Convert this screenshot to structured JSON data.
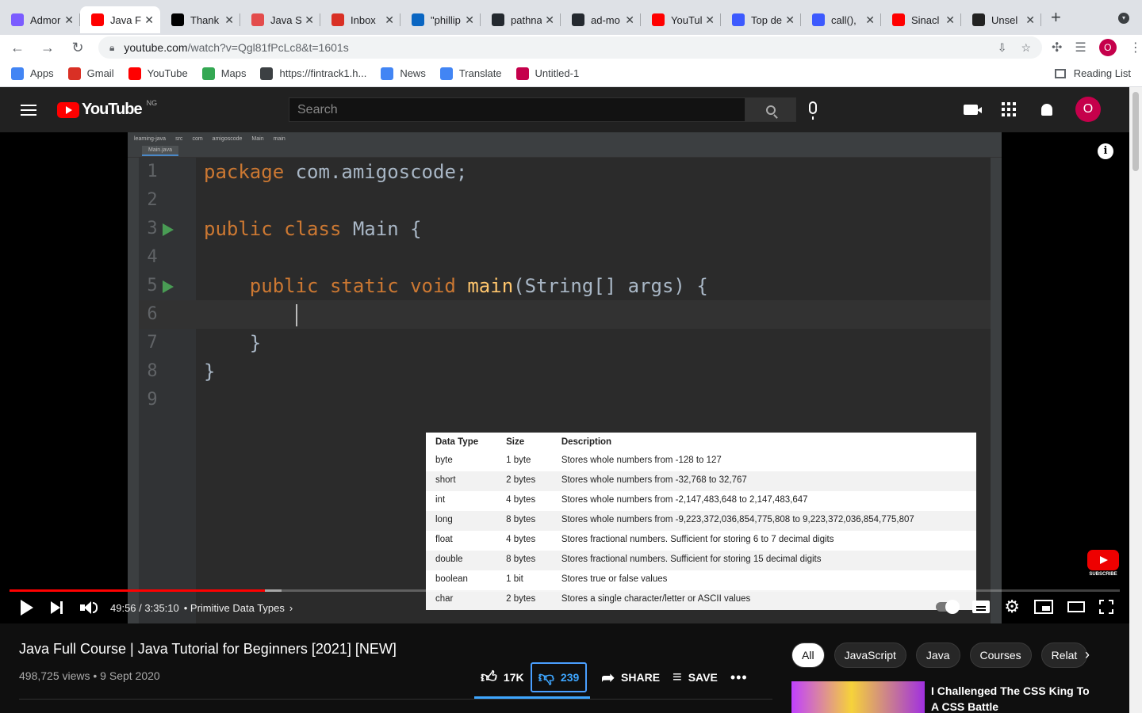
{
  "browser": {
    "tabs": [
      {
        "title": "Admor",
        "color": "#7b5cff",
        "active": false
      },
      {
        "title": "Java F",
        "color": "#ff0000",
        "active": true
      },
      {
        "title": "Thank",
        "color": "#000000",
        "active": false
      },
      {
        "title": "Java S",
        "color": "#e34c4c",
        "active": false
      },
      {
        "title": "Inbox",
        "color": "#d93025",
        "active": false
      },
      {
        "title": "\"phillip",
        "color": "#0a66c2",
        "active": false
      },
      {
        "title": "pathna",
        "color": "#24292f",
        "active": false
      },
      {
        "title": "ad-mo",
        "color": "#24292f",
        "active": false
      },
      {
        "title": "YouTul",
        "color": "#ff0000",
        "active": false
      },
      {
        "title": "Top de",
        "color": "#3d5afe",
        "active": false
      },
      {
        "title": "call(),",
        "color": "#3d5afe",
        "active": false
      },
      {
        "title": "Sinacl",
        "color": "#ff0000",
        "active": false
      },
      {
        "title": "Unsel",
        "color": "#222222",
        "active": false
      }
    ],
    "new_tab_glyph": "+",
    "url_host": "youtube.com",
    "url_path": "/watch?v=Qgl81fPcLc8&t=1601s",
    "profile_initial": "O",
    "bookmarks": [
      {
        "label": "Apps",
        "color": "#4285f4"
      },
      {
        "label": "Gmail",
        "color": "#d93025"
      },
      {
        "label": "YouTube",
        "color": "#ff0000"
      },
      {
        "label": "Maps",
        "color": "#34a853"
      },
      {
        "label": "https://fintrack1.h...",
        "color": "#3c4043"
      },
      {
        "label": "News",
        "color": "#4285f4"
      },
      {
        "label": "Translate",
        "color": "#4285f4"
      },
      {
        "label": "Untitled-1",
        "color": "#c5004b"
      }
    ],
    "reading_list": "Reading List"
  },
  "youtube": {
    "logo_text": "YouTube",
    "region": "NG",
    "search_placeholder": "Search",
    "avatar_initial": "O"
  },
  "video": {
    "ide_breadcrumb": [
      "learning-java",
      "src",
      "com",
      "amigoscode",
      "Main",
      "main"
    ],
    "ide_tab": "Main.java",
    "code_lines": [
      {
        "num": "1",
        "run": false,
        "current": false
      },
      {
        "num": "2",
        "run": false,
        "current": false
      },
      {
        "num": "3",
        "run": true,
        "current": false
      },
      {
        "num": "4",
        "run": false,
        "current": false
      },
      {
        "num": "5",
        "run": true,
        "current": false
      },
      {
        "num": "6",
        "run": false,
        "current": true
      },
      {
        "num": "7",
        "run": false,
        "current": false
      },
      {
        "num": "8",
        "run": false,
        "current": false
      },
      {
        "num": "9",
        "run": false,
        "current": false
      }
    ],
    "code_text": {
      "l1_kw": "package",
      "l1_rest": " com.amigoscode;",
      "l3_kw": "public class",
      "l3_rest": " Main {",
      "l5_kw": "public static void",
      "l5_fn": "main",
      "l5_rest": "(String[] args) {",
      "l7": "}",
      "l8": "}"
    },
    "table": {
      "headers": [
        "Data Type",
        "Size",
        "Description"
      ],
      "rows": [
        [
          "byte",
          "1 byte",
          "Stores whole numbers from -128 to 127"
        ],
        [
          "short",
          "2 bytes",
          "Stores whole numbers from -32,768 to 32,767"
        ],
        [
          "int",
          "4 bytes",
          "Stores whole numbers from -2,147,483,648 to 2,147,483,647"
        ],
        [
          "long",
          "8 bytes",
          "Stores whole numbers from -9,223,372,036,854,775,808 to 9,223,372,036,854,775,807"
        ],
        [
          "float",
          "4 bytes",
          "Stores fractional numbers. Sufficient for storing 6 to 7 decimal digits"
        ],
        [
          "double",
          "8 bytes",
          "Stores fractional numbers. Sufficient for storing 15 decimal digits"
        ],
        [
          "boolean",
          "1 bit",
          "Stores true or false values"
        ],
        [
          "char",
          "2 bytes",
          "Stores a single character/letter or ASCII values"
        ]
      ]
    },
    "subscribe_watermark": "SUBSCRIBE",
    "time_display": "49:56 / 3:35:10",
    "chapter": "• Primitive Data Types",
    "progress_played_fraction": 0.23,
    "progress_loaded_fraction": 0.245
  },
  "details": {
    "title": "Java Full Course | Java Tutorial for Beginners [2021] [NEW]",
    "meta": "498,725 views • 9 Sept 2020",
    "likes": "17K",
    "dislikes": "239",
    "share": "SHARE",
    "save": "SAVE",
    "more": "•••"
  },
  "sidebar": {
    "chips": [
      "All",
      "JavaScript",
      "Java",
      "Courses",
      "Relat"
    ],
    "recommendation_title": "I Challenged The CSS King To A CSS Battle"
  },
  "colors": {
    "accent_red": "#ff0000",
    "dislike_blue": "#3ea6ff",
    "avatar": "#c5004b"
  }
}
